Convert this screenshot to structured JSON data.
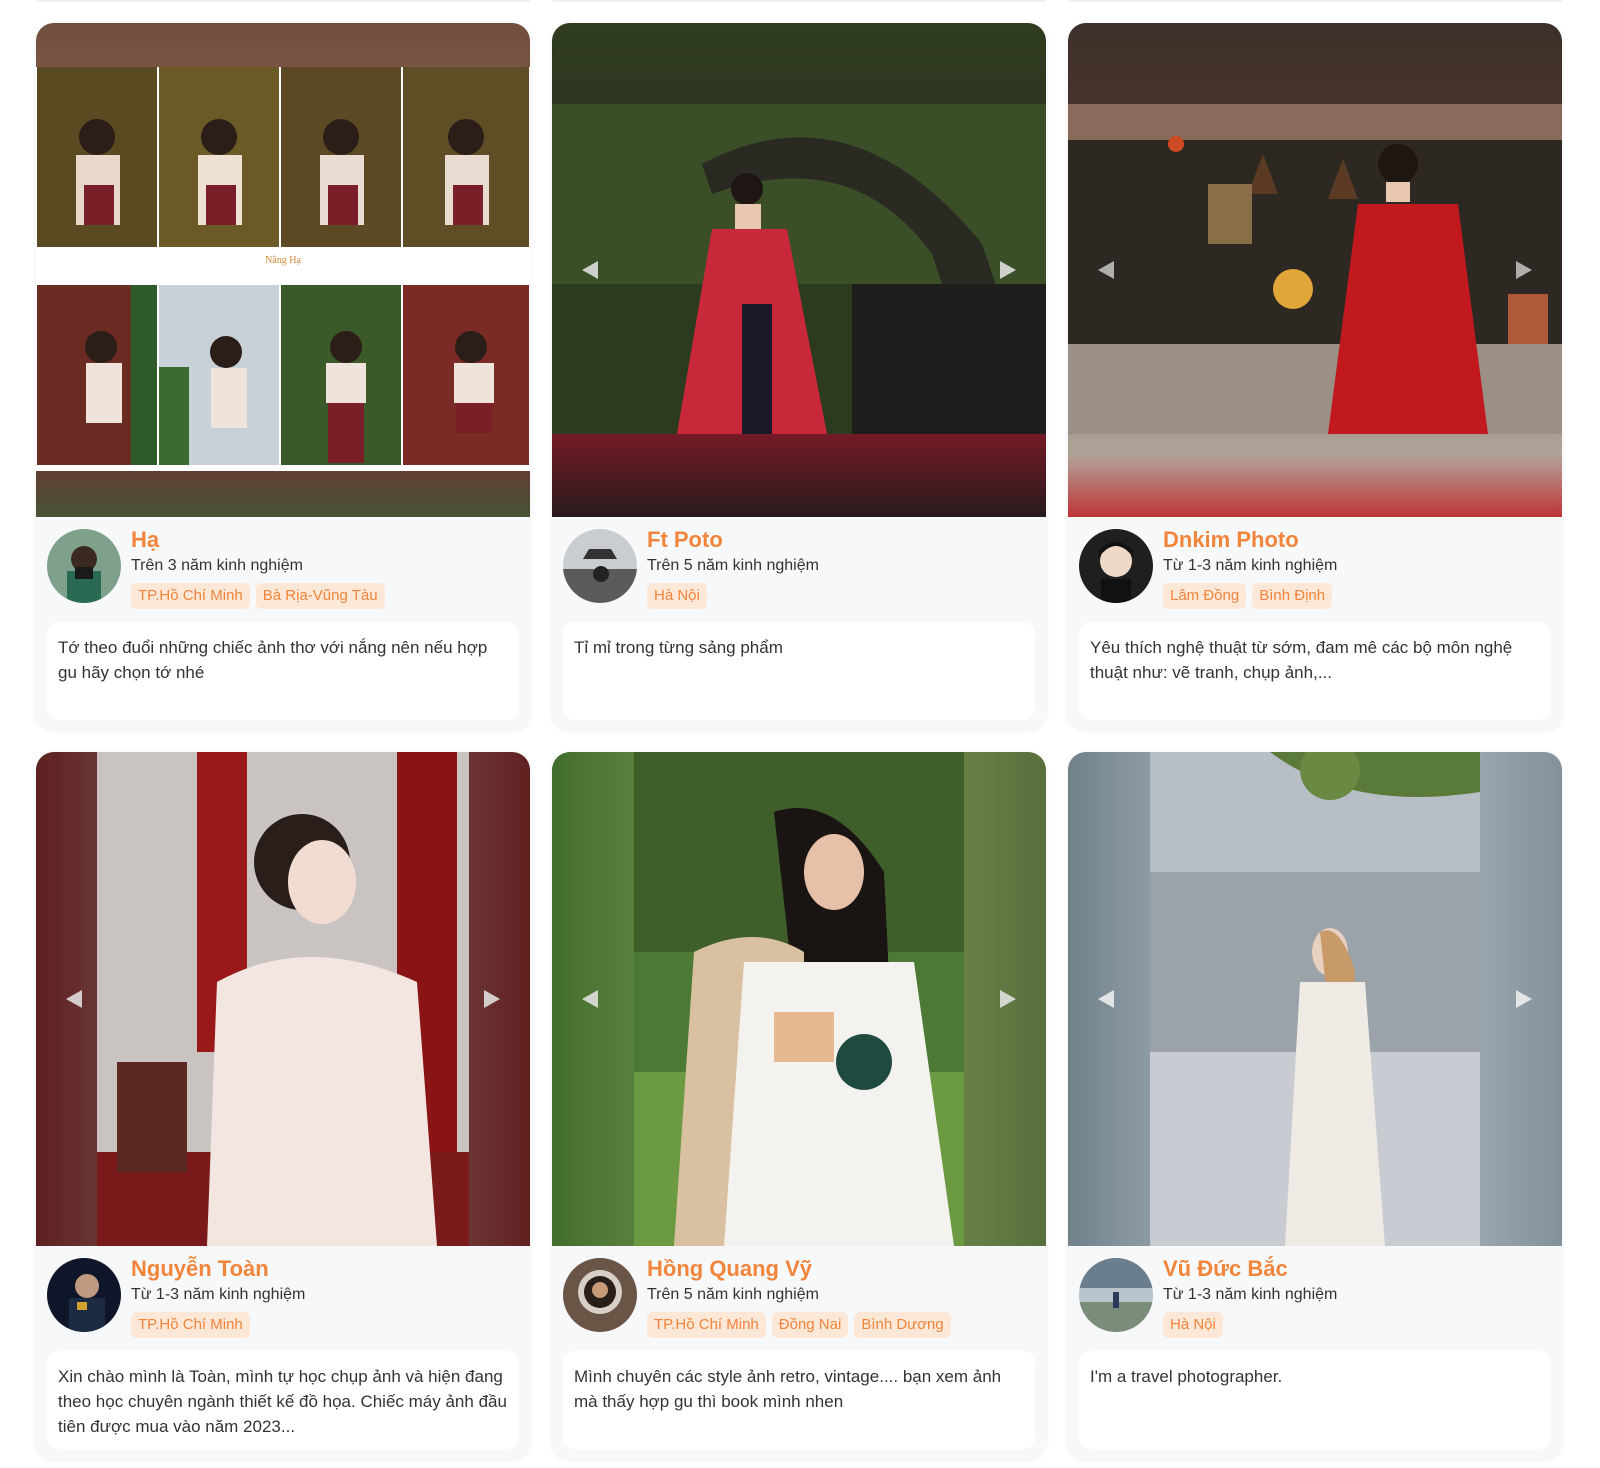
{
  "colors": {
    "accent": "#f0853b",
    "tag_bg": "#fde7d6",
    "card_bg": "#f7f8fa"
  },
  "photographers": [
    {
      "name": "Hạ",
      "experience": "Trên 3 năm kinh nghiệm",
      "locations": [
        "TP.Hồ Chí Minh",
        "Bà Rịa-Vũng Tàu"
      ],
      "description": "Tớ theo đuổi những chiếc ảnh thơ với nắng nên nếu hợp gu hãy chọn tớ nhé",
      "photo_watermark": "Nắng Hạ",
      "show_arrows": false
    },
    {
      "name": "Ft Poto",
      "experience": "Trên 5 năm kinh nghiệm",
      "locations": [
        "Hà Nội"
      ],
      "description": "Tỉ mỉ trong từng sảng phẩm",
      "show_arrows": true
    },
    {
      "name": "Dnkim Photo",
      "experience": "Từ 1-3 năm kinh nghiệm",
      "locations": [
        "Lâm Đồng",
        "Bình Định"
      ],
      "description": "Yêu thích nghệ thuật từ sớm, đam mê các bộ môn nghệ thuật như: vẽ tranh, chụp ảnh,...",
      "show_arrows": true
    },
    {
      "name": "Nguyễn Toàn",
      "experience": "Từ 1-3 năm kinh nghiệm",
      "locations": [
        "TP.Hồ Chí Minh"
      ],
      "description": "Xin chào mình là Toàn, mình tự học chụp ảnh và hiện đang theo học chuyên ngành thiết kế đồ họa. Chiếc máy ảnh đầu tiên được mua vào năm 2023...",
      "show_arrows": true
    },
    {
      "name": "Hồng Quang Vỹ",
      "experience": "Trên 5 năm kinh nghiệm",
      "locations": [
        "TP.Hồ Chí Minh",
        "Đồng Nai",
        "Bình Dương"
      ],
      "description": "Mình chuyên các style ảnh retro, vintage.... bạn xem ảnh mà thấy hợp gu thì book mình nhen",
      "show_arrows": true
    },
    {
      "name": "Vũ Đức Bắc",
      "experience": "Từ 1-3 năm kinh nghiệm",
      "locations": [
        "Hà Nội"
      ],
      "description": "I'm a travel photographer.",
      "show_arrows": true
    }
  ]
}
